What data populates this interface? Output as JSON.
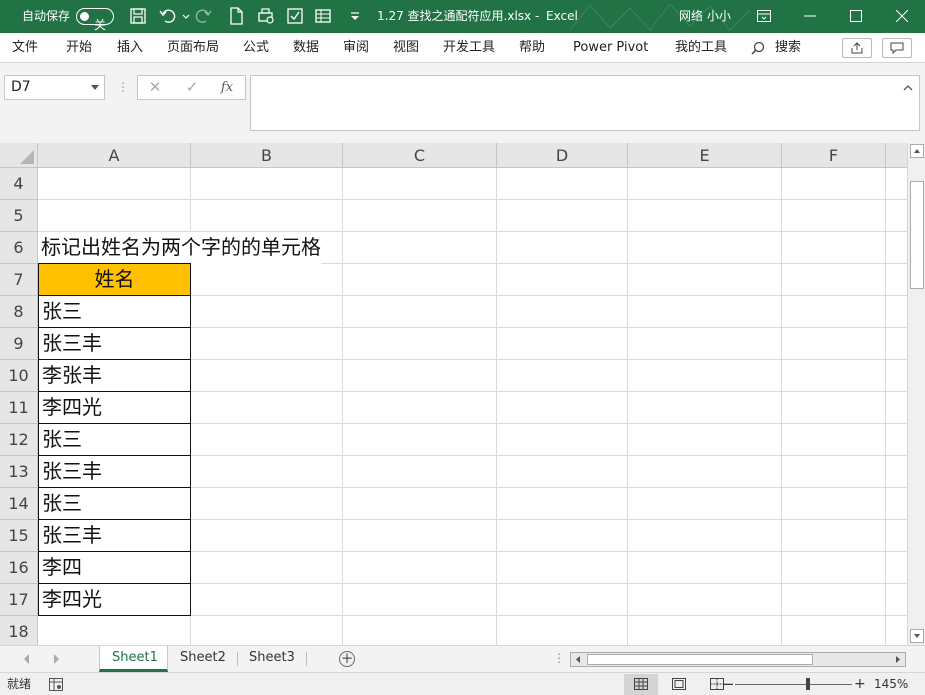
{
  "titlebar": {
    "autosave_label": "自动保存",
    "autosave_state": "关",
    "filename": "1.27 查找之通配符应用.xlsx",
    "separator": "-",
    "app": "Excel",
    "user": "网络 小小",
    "colors": {
      "bar": "#217346",
      "text": "#ffffff"
    }
  },
  "ribbon": {
    "tabs": [
      "文件",
      "开始",
      "插入",
      "页面布局",
      "公式",
      "数据",
      "审阅",
      "视图",
      "开发工具",
      "帮助",
      "Power Pivot",
      "我的工具"
    ],
    "search_label": "搜索"
  },
  "formula_bar": {
    "name_box": "D7",
    "cancel": "✕",
    "enter": "✓",
    "fx": "fx",
    "content": ""
  },
  "grid": {
    "columns": [
      "A",
      "B",
      "C",
      "D",
      "E",
      "F"
    ],
    "rows": [
      "4",
      "5",
      "6",
      "7",
      "8",
      "9",
      "10",
      "11",
      "12",
      "13",
      "14",
      "15",
      "16",
      "17",
      "18"
    ],
    "title_cell": "标记出姓名为两个字的的单元格",
    "table_header": "姓名",
    "names": [
      "张三",
      "张三丰",
      "李张丰",
      "李四光",
      "张三",
      "张三丰",
      "张三",
      "张三丰",
      "李四",
      "李四光"
    ],
    "header_fill": "#ffc000"
  },
  "sheets": {
    "tabs": [
      "Sheet1",
      "Sheet2",
      "Sheet3"
    ],
    "active": "Sheet1",
    "add_label": "+"
  },
  "statusbar": {
    "ready": "就绪",
    "zoom": "145%",
    "zoom_out": "−",
    "zoom_in": "+"
  }
}
